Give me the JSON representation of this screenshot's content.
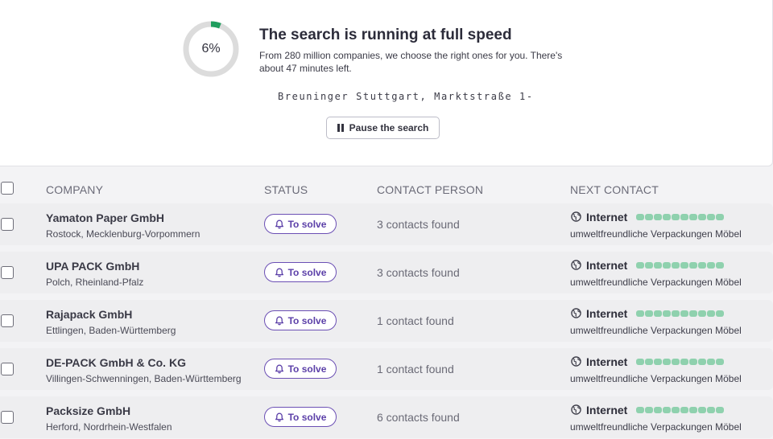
{
  "search": {
    "progress_percent": 6,
    "progress_label": "6%",
    "title": "The search is running at full speed",
    "description": "From 280 million companies, we choose the right ones for you. There's about 47 minutes left.",
    "current_address": "Breuninger Stuttgart, Marktstraße 1-",
    "pause_label": "Pause the search",
    "colors": {
      "progress": "#1f9e5e",
      "track": "#dcdcdc"
    }
  },
  "table": {
    "columns": [
      "COMPANY",
      "STATUS",
      "CONTACT PERSON",
      "NEXT CONTACT"
    ],
    "rows": [
      {
        "company": "Yamaton Paper GmbH",
        "location": "Rostock, Mecklenburg-Vorpommern",
        "status": "To solve",
        "contacts": "3 contacts found",
        "source": "Internet",
        "keywords": "umweltfreundliche Verpackungen Möbel"
      },
      {
        "company": "UPA PACK GmbH",
        "location": "Polch, Rheinland-Pfalz",
        "status": "To solve",
        "contacts": "3 contacts found",
        "source": "Internet",
        "keywords": "umweltfreundliche Verpackungen Möbel"
      },
      {
        "company": "Rajapack GmbH",
        "location": "Ettlingen, Baden-Württemberg",
        "status": "To solve",
        "contacts": "1 contact found",
        "source": "Internet",
        "keywords": "umweltfreundliche Verpackungen Möbel"
      },
      {
        "company": "DE-PACK GmbH & Co. KG",
        "location": "Villingen-Schwenningen, Baden-Württemberg",
        "status": "To solve",
        "contacts": "1 contact found",
        "source": "Internet",
        "keywords": "umweltfreundliche Verpackungen Möbel"
      },
      {
        "company": "Packsize GmbH",
        "location": "Herford, Nordrhein-Westfalen",
        "status": "To solve",
        "contacts": "6 contacts found",
        "source": "Internet",
        "keywords": "umweltfreundliche Verpackungen Möbel"
      }
    ],
    "icons": {
      "status": "bell-icon",
      "source": "globe-icon"
    },
    "colors": {
      "status_accent": "#5b3fa8",
      "source_bar": "#8fd1ae"
    }
  }
}
